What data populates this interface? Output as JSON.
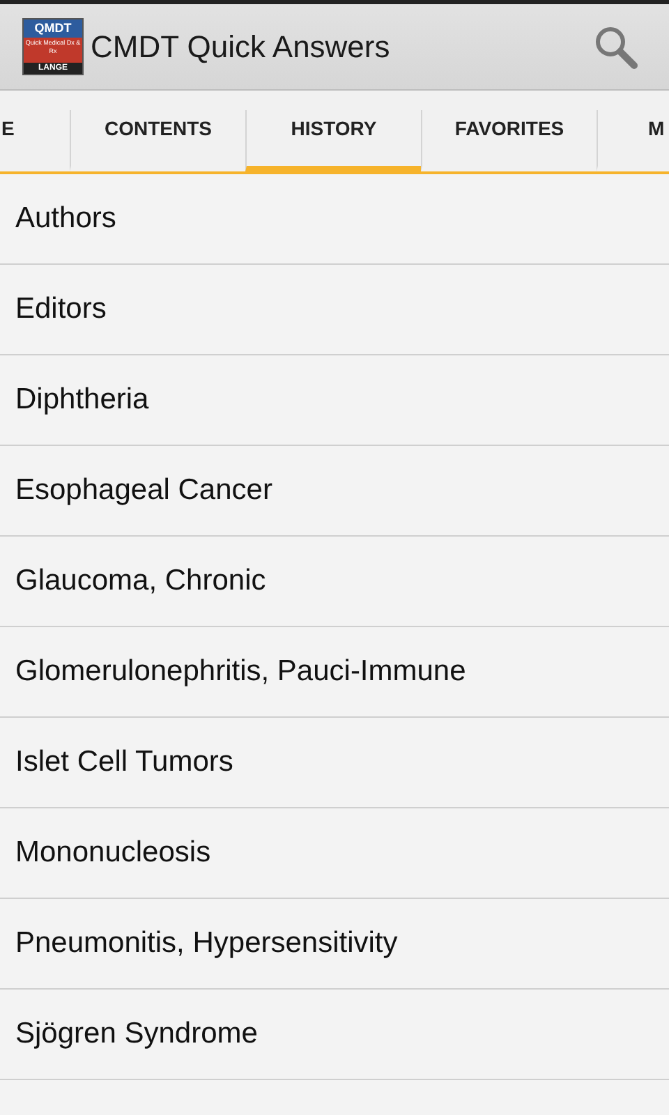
{
  "app_bar": {
    "logo": {
      "title": "QMDT",
      "subtitle": "Quick Medical Dx & Rx",
      "publisher": "LANGE"
    },
    "title": "CMDT Quick Answers"
  },
  "tabs": [
    {
      "label": "E",
      "selected": false
    },
    {
      "label": "CONTENTS",
      "selected": false
    },
    {
      "label": "HISTORY",
      "selected": true
    },
    {
      "label": "FAVORITES",
      "selected": false
    },
    {
      "label": "M",
      "selected": false
    }
  ],
  "history": [
    "Authors",
    "Editors",
    "Diphtheria",
    "Esophageal Cancer",
    "Glaucoma, Chronic",
    "Glomerulonephritis, Pauci-Immune",
    "Islet Cell Tumors",
    "Mononucleosis",
    "Pneumonitis, Hypersensitivity",
    "Sjögren Syndrome"
  ]
}
